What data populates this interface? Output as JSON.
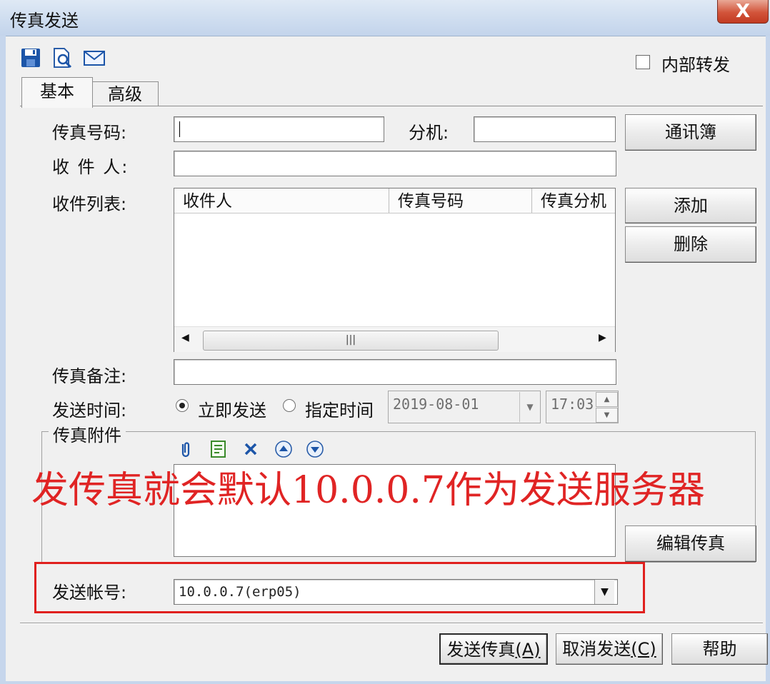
{
  "window": {
    "title": "传真发送",
    "close_glyph": "X"
  },
  "toolbar": {
    "icons": [
      "save-icon",
      "preview-icon",
      "email-icon"
    ]
  },
  "options": {
    "internal_forward_label": "内部转发",
    "internal_forward_checked": false
  },
  "tabs": [
    {
      "label": "基本",
      "active": true
    },
    {
      "label": "高级",
      "active": false
    }
  ],
  "form": {
    "fax_number_label": "传真号码:",
    "fax_number_value": "",
    "extension_label": "分机:",
    "extension_value": "",
    "recipient_label": "收 件 人:",
    "recipient_value": "",
    "recipient_list_label": "收件列表:",
    "list_columns": [
      "收件人",
      "传真号码",
      "传真分机"
    ],
    "note_label": "传真备注:",
    "note_value": "",
    "send_time_label": "发送时间:",
    "send_now_label": "立即发送",
    "scheduled_label": "指定时间",
    "send_mode": "now",
    "date_value": "2019-08-01",
    "time_value": "17:03",
    "attachments_label": "传真附件",
    "account_label": "发送帐号:",
    "account_value": "10.0.0.7(erp05)"
  },
  "buttons": {
    "address_book": "通讯簿",
    "add": "添加",
    "delete": "删除",
    "edit_fax": "编辑传真",
    "send_text": "发送传真",
    "send_key": "(A)",
    "cancel_text": "取消发送",
    "cancel_key": "(C)",
    "help": "帮助"
  },
  "annotation": {
    "text": "发传真就会默认10.0.0.7作为发送服务器",
    "color": "#e02424"
  },
  "colors": {
    "annotation_box": "#e0201e",
    "icon_blue": "#1c55a8"
  }
}
